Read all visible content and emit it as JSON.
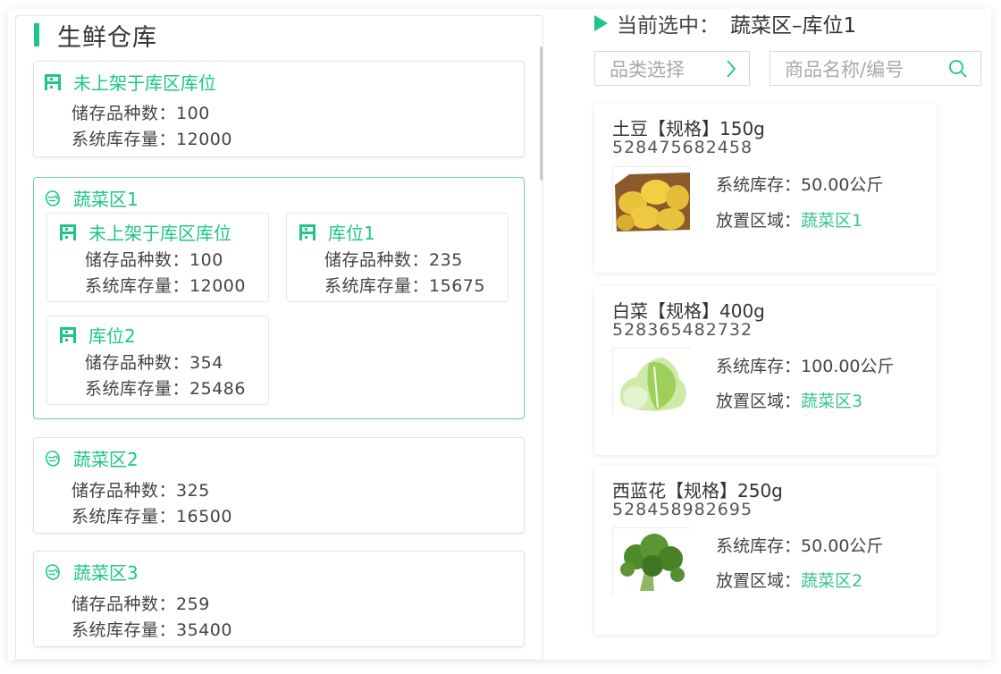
{
  "warehouse": {
    "title": "生鲜仓库",
    "unshelved": {
      "label": "未上架于库区库位",
      "species_label": "储存品种数：",
      "species": "100",
      "stock_label": "系统库存量：",
      "stock": "12000"
    },
    "zones": [
      {
        "name": "蔬菜区1",
        "selected": true,
        "locations": [
          {
            "name": "未上架于库区库位",
            "species_label": "储存品种数：",
            "species": "100",
            "stock_label": "系统库存量：",
            "stock": "12000"
          },
          {
            "name": "库位1",
            "species_label": "储存品种数：",
            "species": "235",
            "stock_label": "系统库存量：",
            "stock": "15675"
          },
          {
            "name": "库位2",
            "species_label": "储存品种数：",
            "species": "354",
            "stock_label": "系统库存量：",
            "stock": "25486"
          }
        ]
      },
      {
        "name": "蔬菜区2",
        "species_label": "储存品种数：",
        "species": "325",
        "stock_label": "系统库存量：",
        "stock": "16500"
      },
      {
        "name": "蔬菜区3",
        "species_label": "储存品种数：",
        "species": "259",
        "stock_label": "系统库存量：",
        "stock": "35400"
      }
    ]
  },
  "current": {
    "label": "当前选中：",
    "value": "蔬菜区–库位1"
  },
  "filters": {
    "category_placeholder": "品类选择",
    "search_placeholder": "商品名称/编号"
  },
  "products": [
    {
      "name": "土豆【规格】150g",
      "code": "528475682458",
      "stock_label": "系统库存：",
      "stock": "50.00公斤",
      "area_label": "放置区域：",
      "area": "蔬菜区1",
      "image": "potato"
    },
    {
      "name": "白菜【规格】400g",
      "code": "528365482732",
      "stock_label": "系统库存：",
      "stock": "100.00公斤",
      "area_label": "放置区域：",
      "area": "蔬菜区3",
      "image": "cabbage"
    },
    {
      "name": "西蓝花【规格】250g",
      "code": "528458982695",
      "stock_label": "系统库存：",
      "stock": "50.00公斤",
      "area_label": "放置区域：",
      "area": "蔬菜区2",
      "image": "broccoli"
    }
  ],
  "colors": {
    "accent": "#1cc785",
    "area_text": "#37c588"
  }
}
